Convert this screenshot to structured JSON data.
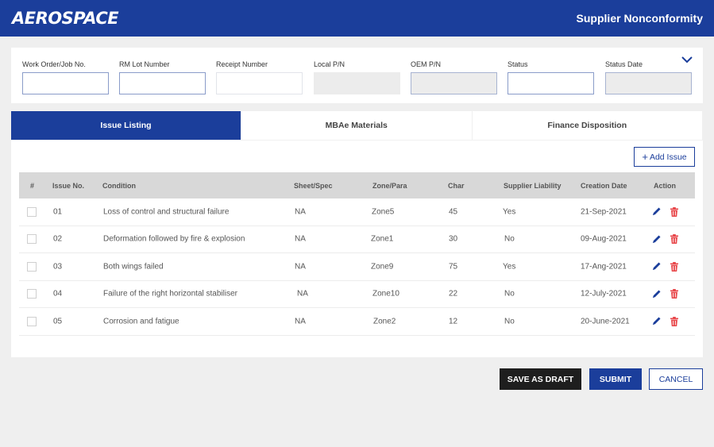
{
  "header": {
    "brand": "AEROSPACE",
    "title": "Supplier Nonconformity"
  },
  "filters": {
    "fields": [
      {
        "label": "Work Order/Job No.",
        "value": "",
        "state": "editable"
      },
      {
        "label": "RM Lot Number",
        "value": "",
        "state": "editable"
      },
      {
        "label": "Receipt Number",
        "value": "",
        "state": "editable"
      },
      {
        "label": "Local P/N",
        "value": "",
        "state": "disabled"
      },
      {
        "label": "OEM P/N",
        "value": "",
        "state": "disabled"
      },
      {
        "label": "Status",
        "value": "",
        "state": "editable"
      },
      {
        "label": "Status Date",
        "value": "",
        "state": "disabled"
      }
    ],
    "collapse_icon": "chevron-down-icon"
  },
  "tabs": [
    {
      "label": "Issue Listing",
      "active": true
    },
    {
      "label": "MBAe Materials",
      "active": false
    },
    {
      "label": "Finance Disposition",
      "active": false
    }
  ],
  "add_issue": {
    "icon": "+",
    "label": "Add Issue"
  },
  "table": {
    "columns": [
      "#",
      "Issue No.",
      "Condition",
      "Sheet/Spec",
      "Zone/Para",
      "Char",
      "Supplier Liability",
      "Creation Date",
      "Action"
    ],
    "rows": [
      {
        "checked": false,
        "issue_no": "01",
        "condition": "Loss of control and structural failure",
        "sheet_spec": "NA",
        "zone_para": "Zone5",
        "char": "45",
        "supplier_liability": "Yes",
        "creation_date": "21-Sep-2021"
      },
      {
        "checked": false,
        "issue_no": "02",
        "condition": "Deformation followed by fire & explosion",
        "sheet_spec": "NA",
        "zone_para": "Zone1",
        "char": "30",
        "supplier_liability": "No",
        "creation_date": "09-Aug-2021"
      },
      {
        "checked": false,
        "issue_no": "03",
        "condition": "Both wings failed",
        "sheet_spec": "NA",
        "zone_para": "Zone9",
        "char": "75",
        "supplier_liability": "Yes",
        "creation_date": "17-Ang-2021"
      },
      {
        "checked": false,
        "issue_no": "04",
        "condition": "Failure of the right horizontal stabiliser",
        "sheet_spec": "NA",
        "zone_para": "Zone10",
        "char": "22",
        "supplier_liability": "No",
        "creation_date": "12-July-2021"
      },
      {
        "checked": false,
        "issue_no": "05",
        "condition": "Corrosion and fatigue",
        "sheet_spec": "NA",
        "zone_para": "Zone2",
        "char": "12",
        "supplier_liability": "No",
        "creation_date": "20-June-2021"
      }
    ],
    "action_icons": [
      "pencil-edit-icon",
      "trash-delete-icon"
    ]
  },
  "footer": {
    "save_draft": "SAVE AS DRAFT",
    "submit": "SUBMIT",
    "cancel": "CANCEL"
  },
  "colors": {
    "primary": "#1b3e9b",
    "dark": "#1e1e1e",
    "delete": "#e8474a",
    "background": "#efefef"
  }
}
